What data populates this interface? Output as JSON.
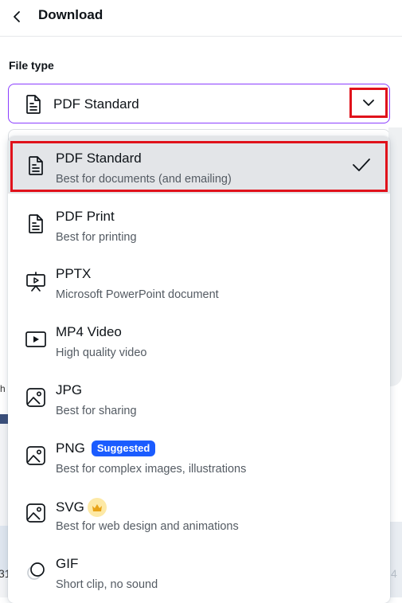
{
  "header": {
    "title": "Download"
  },
  "file_type": {
    "label": "File type",
    "selected_value": "PDF Standard"
  },
  "background": {
    "partial_text_left": "h",
    "partial_number_left": "31",
    "partial_number_right": "4"
  },
  "options": [
    {
      "name": "PDF Standard",
      "desc": "Best for documents (and emailing)",
      "icon": "document-icon",
      "selected": true
    },
    {
      "name": "PDF Print",
      "desc": "Best for printing",
      "icon": "document-icon"
    },
    {
      "name": "PPTX",
      "desc": "Microsoft PowerPoint document",
      "icon": "presentation-icon"
    },
    {
      "name": "MP4 Video",
      "desc": "High quality video",
      "icon": "video-icon"
    },
    {
      "name": "JPG",
      "desc": "Best for sharing",
      "icon": "image-icon"
    },
    {
      "name": "PNG",
      "desc": "Best for complex images, illustrations",
      "icon": "image-icon",
      "badge": "Suggested"
    },
    {
      "name": "SVG",
      "desc": "Best for web design and animations",
      "icon": "image-icon",
      "premium": "crown-icon"
    },
    {
      "name": "GIF",
      "desc": "Short clip, no sound",
      "icon": "gif-icon"
    }
  ],
  "colors": {
    "accent_purple": "#8b3dff",
    "highlight_red": "#e0121b",
    "badge_blue": "#1b5cff",
    "crown_bg": "#fde9a6"
  }
}
